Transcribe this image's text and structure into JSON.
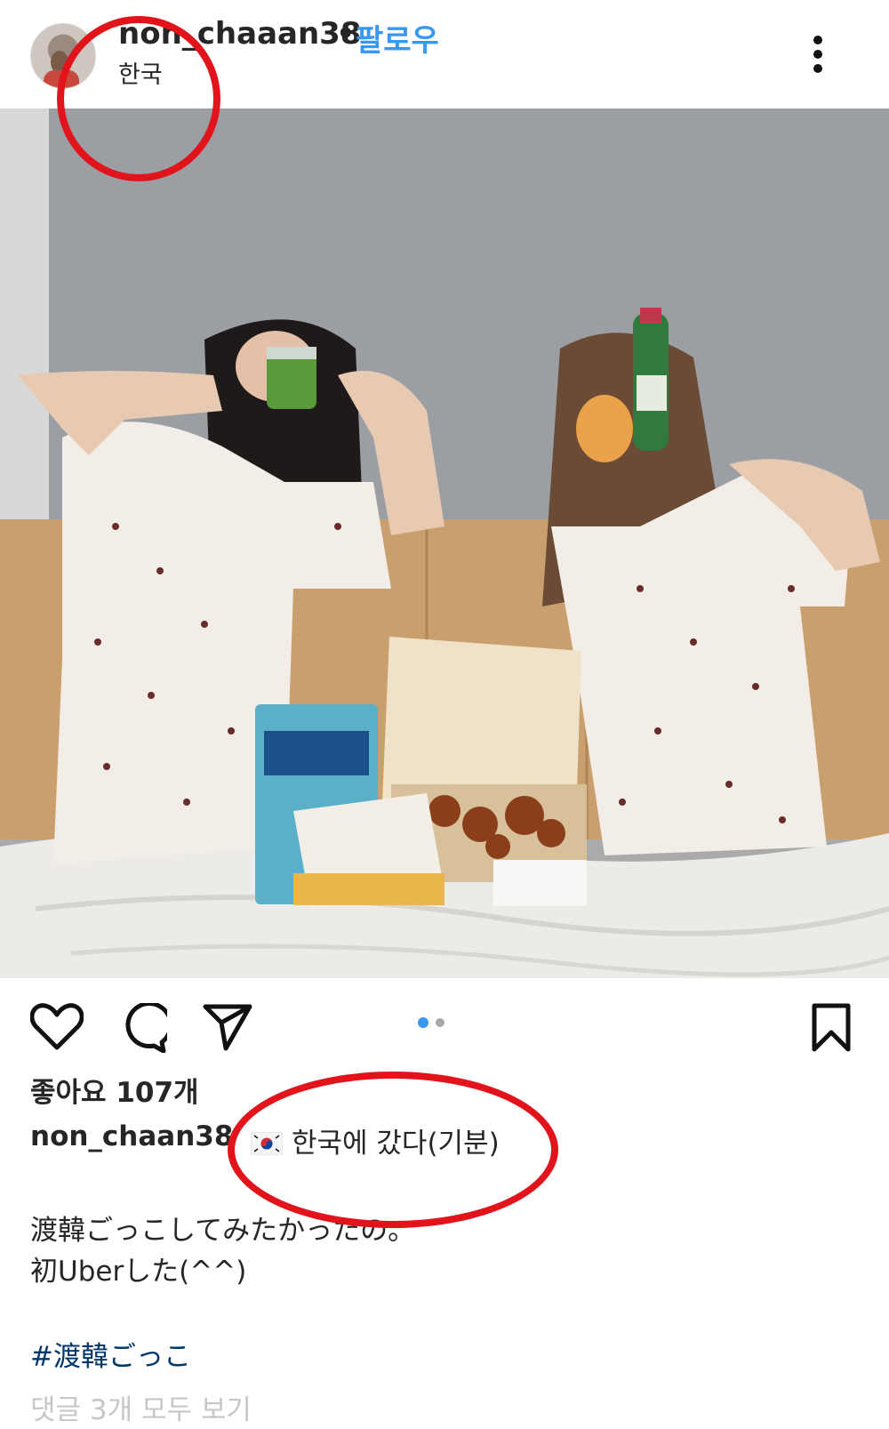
{
  "header": {
    "username": "non_chaaan38",
    "separator": "•",
    "follow_label": "팔로우",
    "location": "한국",
    "more_icon": "more-vertical-icon"
  },
  "post": {
    "photo_description": "",
    "carousel": {
      "count": 2,
      "active_index": 0
    }
  },
  "actions": {
    "like_icon": "heart-icon",
    "comment_icon": "comment-icon",
    "share_icon": "paper-plane-icon",
    "save_icon": "bookmark-icon"
  },
  "likes_text": "좋아요 107개",
  "caption": {
    "username": "non_chaan38",
    "flag": "south-korea-flag-emoji",
    "text": "한국에 갔다(기분)",
    "line1": "渡韓ごっこしてみたかったの。",
    "line2": "初Uberした(^^)",
    "hashtag": "#渡韓ごっこ"
  },
  "comments_link": "댓글 3개 모두 보기",
  "colors": {
    "accent_blue": "#3897f0",
    "highlight_red": "#e1141c",
    "hashtag_blue": "#00376b",
    "text": "#262626"
  }
}
